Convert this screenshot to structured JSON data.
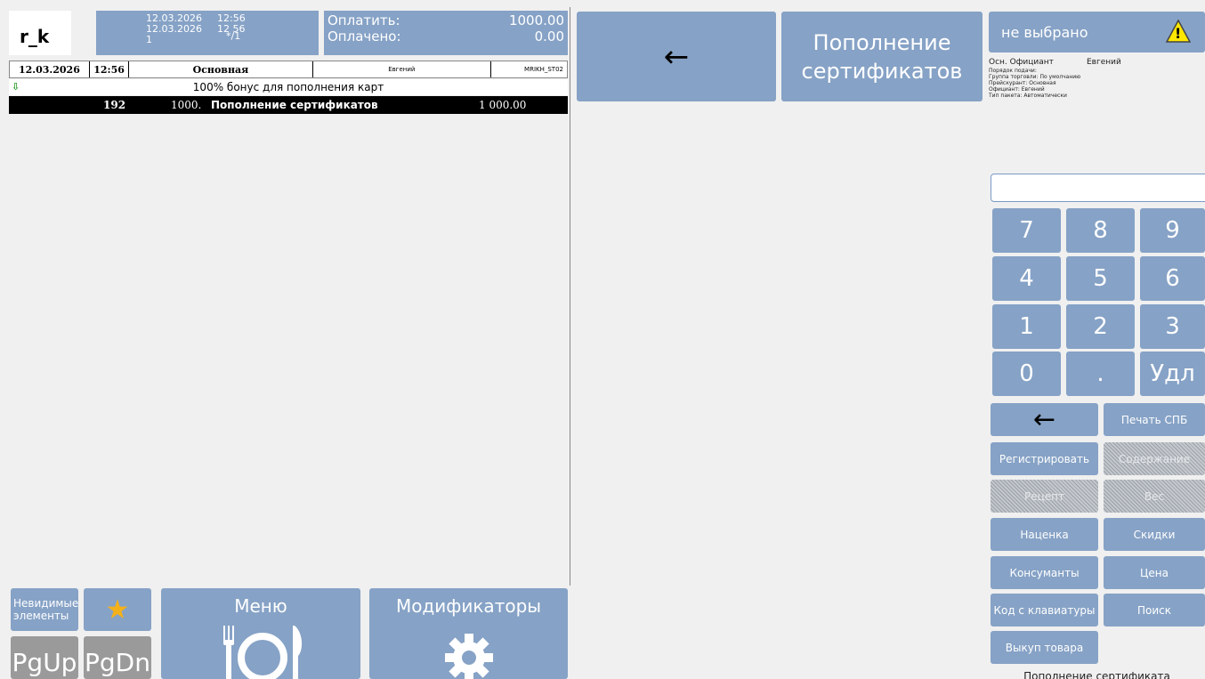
{
  "logo": "r_k",
  "header": {
    "date1": "12.03.2026",
    "time1": "12:56",
    "date2": "12.03.2026",
    "time2": "12 56",
    "num": "1",
    "suffix": "*/1",
    "pay_label": "Оплатить:",
    "pay_value": "1000.00",
    "paid_label": "Оплачено:",
    "paid_value": "0.00"
  },
  "order_header": {
    "date": "12.03.2026",
    "time": "12:56",
    "tariff": "Основная",
    "waiter": "Евгений",
    "station": "MRIKH_ST02"
  },
  "bonus_line": "100% бонус для пополнения карт",
  "order_row": {
    "code": "192",
    "qty": "1000.",
    "name": "Пополнение сертификатов",
    "sum": "1 000.00"
  },
  "top_buttons": {
    "back_glyph": "←",
    "category_label": "Пополнение сертификатов"
  },
  "status": {
    "label": "не выбрано",
    "warning_glyph": "!"
  },
  "info": {
    "waiter_label": "Осн. Официант",
    "waiter_value": "Евгений",
    "lines": [
      "Порядок подачи:",
      "Группа торговли: По умолчанию",
      "Прейскурант: Основная",
      "Официант: Евгений",
      "Тип пакета: Автоматически"
    ]
  },
  "keypad": {
    "keys": [
      "7",
      "8",
      "9",
      "4",
      "5",
      "6",
      "1",
      "2",
      "3",
      "0",
      ".",
      "Удл"
    ]
  },
  "functions": {
    "back_glyph": "←",
    "print_spb": "Печать СПБ",
    "register": "Регистрировать",
    "content": "Содержание",
    "recipe": "Рецепт",
    "weight": "Вес",
    "markup": "Наценка",
    "discounts": "Скидки",
    "consumables": "Консуманты",
    "price": "Цена",
    "keyboard_code": "Код с клавиатуры",
    "search": "Поиск",
    "buyback": "Выкуп товара"
  },
  "footer": "Пополнение сертификата",
  "bottom": {
    "invisible": "Невидимые элементы",
    "star_glyph": "★",
    "pgup": "PgUp",
    "pgdn": "PgDn",
    "menu": "Меню",
    "modifiers": "Модификаторы"
  }
}
